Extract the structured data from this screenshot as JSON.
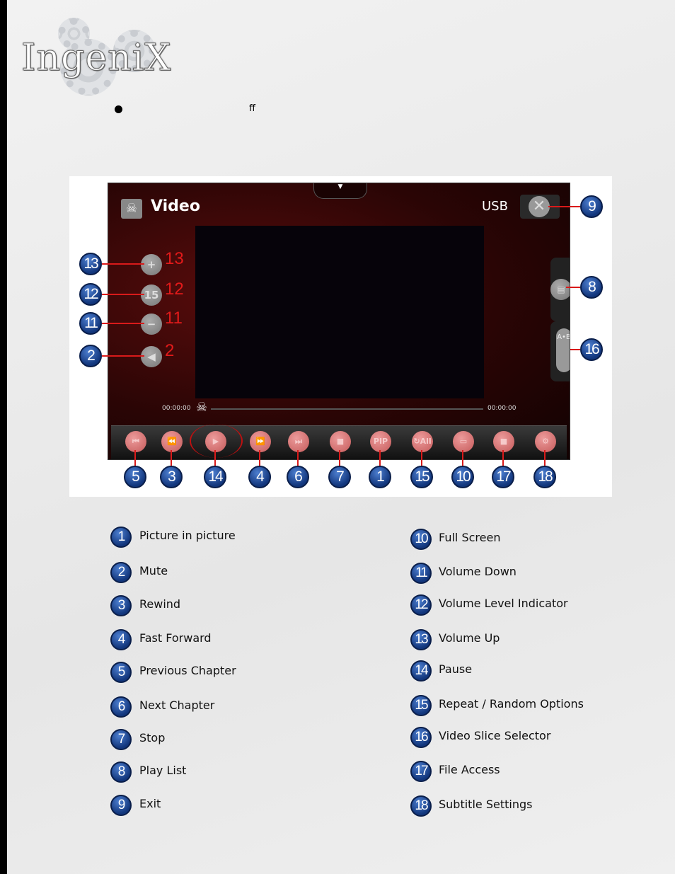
{
  "logo": {
    "text": "IngeniX"
  },
  "intro": {
    "bullet_text": "ff"
  },
  "screen": {
    "title": "Video",
    "source": "USB",
    "time_start": "00:00:00",
    "time_end": "00:00:00",
    "volume_level": "15",
    "ab_label": "A•B",
    "bottom_buttons": [
      {
        "icon": "previous-chapter-icon",
        "glyph": "⏮",
        "callout": "5"
      },
      {
        "icon": "rewind-icon",
        "glyph": "⏪",
        "callout": "3"
      },
      {
        "icon": "play-pause-icon",
        "glyph": "▶",
        "callout": "14"
      },
      {
        "icon": "fast-forward-icon",
        "glyph": "⏩",
        "callout": "4"
      },
      {
        "icon": "next-chapter-icon",
        "glyph": "⏭",
        "callout": "6"
      },
      {
        "icon": "stop-icon",
        "glyph": "■",
        "callout": "7"
      },
      {
        "icon": "pip-icon",
        "glyph": "PIP",
        "callout": "1"
      },
      {
        "icon": "repeat-all-icon",
        "glyph": "↻All",
        "callout": "15"
      },
      {
        "icon": "full-screen-icon",
        "glyph": "▭",
        "callout": "10"
      },
      {
        "icon": "folder-icon",
        "glyph": "■",
        "callout": "17"
      },
      {
        "icon": "settings-gear-icon",
        "glyph": "⚙",
        "callout": "18"
      }
    ],
    "left_buttons": [
      {
        "icon": "volume-up-icon",
        "glyph": "+",
        "red": "13",
        "callout": "13"
      },
      {
        "icon": "volume-level-icon",
        "glyph": "15",
        "red": "12",
        "callout": "12"
      },
      {
        "icon": "volume-down-icon",
        "glyph": "−",
        "red": "11",
        "callout": "11"
      },
      {
        "icon": "mute-icon",
        "glyph": "◀",
        "red": "2",
        "callout": "2"
      }
    ],
    "right_callouts": {
      "exit": "9",
      "playlist": "8",
      "ab": "16"
    }
  },
  "legend": {
    "left": [
      {
        "n": "1",
        "label": "Picture in picture"
      },
      {
        "n": "2",
        "label": "Mute"
      },
      {
        "n": "3",
        "label": "Rewind"
      },
      {
        "n": "4",
        "label": "Fast Forward"
      },
      {
        "n": "5",
        "label": "Previous Chapter"
      },
      {
        "n": "6",
        "label": "Next Chapter"
      },
      {
        "n": "7",
        "label": "Stop"
      },
      {
        "n": "8",
        "label": "Play List"
      },
      {
        "n": "9",
        "label": "Exit"
      }
    ],
    "right": [
      {
        "n": "10",
        "label": "Full Screen"
      },
      {
        "n": "11",
        "label": "Volume Down"
      },
      {
        "n": "12",
        "label": "Volume Level Indicator"
      },
      {
        "n": "13",
        "label": "Volume Up"
      },
      {
        "n": "14",
        "label": "Pause"
      },
      {
        "n": "15",
        "label": "Repeat / Random Options"
      },
      {
        "n": "16",
        "label": "Video Slice Selector"
      },
      {
        "n": "17",
        "label": "File Access"
      },
      {
        "n": "18",
        "label": "Subtitle Settings"
      }
    ]
  },
  "colors": {
    "callout_badge": "#1a4a9c",
    "callout_line": "#d91a1a",
    "screen_bg": "#3a0606"
  }
}
